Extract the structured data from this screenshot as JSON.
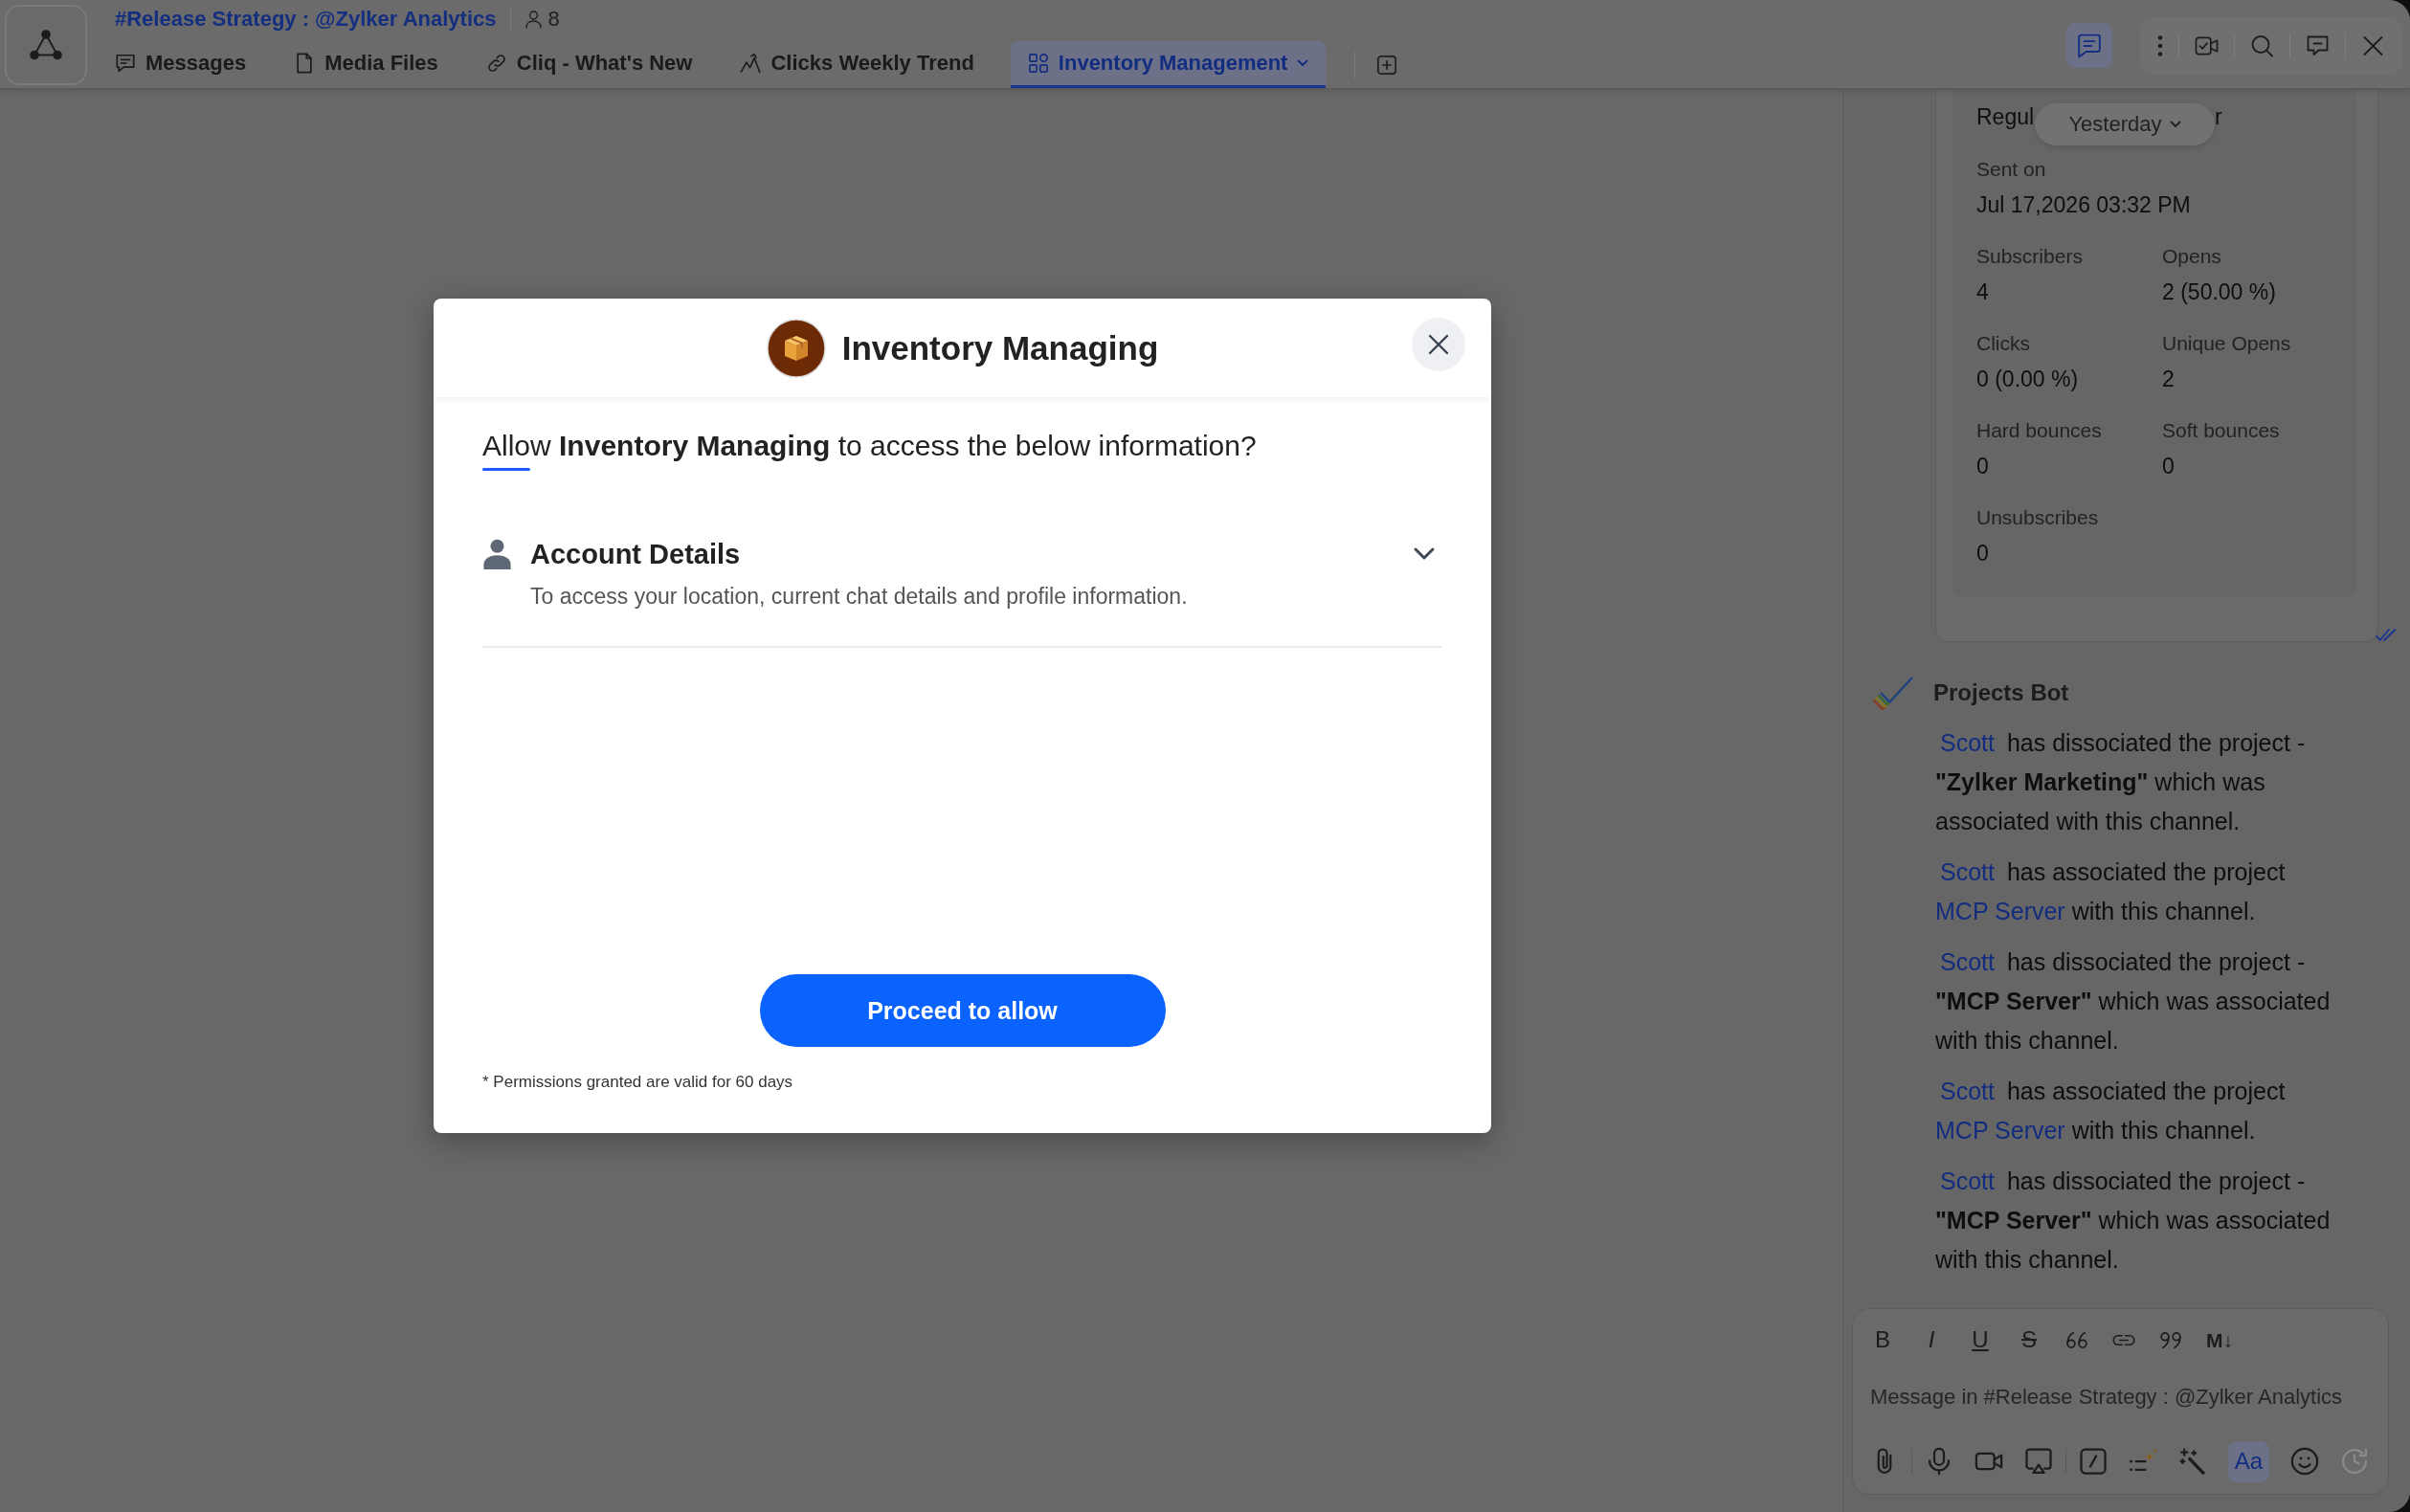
{
  "header": {
    "title": "#Release Strategy : @Zylker Analytics",
    "member_count": "8",
    "tabs": [
      {
        "kind": "chat",
        "label": "Messages",
        "selected": false
      },
      {
        "kind": "file",
        "label": "Media Files",
        "selected": false
      },
      {
        "kind": "link",
        "label": "Cliq - What's New",
        "selected": false
      },
      {
        "kind": "chart",
        "label": "Clicks Weekly Trend",
        "selected": false
      },
      {
        "kind": "widget",
        "label": "Inventory Management",
        "selected": true
      }
    ],
    "panel_toggle": {
      "on": true
    },
    "actions": [
      {
        "kind": "more"
      },
      {
        "kind": "video-call"
      },
      {
        "kind": "search"
      },
      {
        "kind": "thread"
      },
      {
        "kind": "close"
      }
    ]
  },
  "dialog": {
    "app_name": "Inventory Managing",
    "question": "Allow **Inventory Managing** to access the below information?",
    "permissions": [
      {
        "title": "Account Details",
        "description": "To access your location, current chat details and profile information.",
        "expanded": false
      }
    ],
    "primary_button": "Proceed to allow",
    "footnote": "* Permissions granted are valid for 60 days"
  },
  "side_panel": {
    "date_chip": "Yesterday",
    "campaign": {
      "cut_text_left": "Regul",
      "cut_text_right": "r",
      "sent_on": {
        "label": "Sent on",
        "value": "Jul 17,2026 03:32 PM"
      },
      "stats": [
        {
          "label": "Subscribers",
          "value": "4"
        },
        {
          "label": "Opens",
          "value": "2 (50.00 %)"
        },
        {
          "label": "Clicks",
          "value": "0 (0.00 %)"
        },
        {
          "label": "Unique Opens",
          "value": "2"
        },
        {
          "label": "Hard bounces",
          "value": "0"
        },
        {
          "label": "Soft bounces",
          "value": "0"
        },
        {
          "label": "Unsubscribes",
          "value": "0"
        }
      ]
    },
    "bot": {
      "name": "Projects Bot",
      "messages": [
        {
          "parts": [
            {
              "kind": "mention",
              "text": "Scott"
            },
            {
              "kind": "text",
              "text": "has dissociated the project - **\"Zylker Marketing\"** which was associated with this channel."
            }
          ]
        },
        {
          "parts": [
            {
              "kind": "mention",
              "text": "Scott"
            },
            {
              "kind": "text",
              "text": "has associated the project"
            },
            {
              "kind": "link",
              "text": "MCP Server"
            },
            {
              "kind": "text",
              "text": "with this channel."
            }
          ]
        },
        {
          "parts": [
            {
              "kind": "mention",
              "text": "Scott"
            },
            {
              "kind": "text",
              "text": "has dissociated the project - **\"MCP Server\"** which was associated with this channel."
            }
          ]
        },
        {
          "parts": [
            {
              "kind": "mention",
              "text": "Scott"
            },
            {
              "kind": "text",
              "text": "has associated the project"
            },
            {
              "kind": "link",
              "text": "MCP Server"
            },
            {
              "kind": "text",
              "text": "with this channel."
            }
          ]
        },
        {
          "parts": [
            {
              "kind": "mention",
              "text": "Scott"
            },
            {
              "kind": "text",
              "text": "has dissociated the project - **\"MCP Server\"** which was associated with this channel."
            }
          ]
        }
      ]
    },
    "composer": {
      "format_tools": [
        {
          "kind": "bold",
          "label": "B"
        },
        {
          "kind": "italic",
          "label": "I"
        },
        {
          "kind": "underline",
          "label": "U"
        },
        {
          "kind": "strike",
          "label": "S"
        },
        {
          "kind": "quote-open"
        },
        {
          "kind": "link"
        },
        {
          "kind": "quote-close"
        },
        {
          "kind": "markdown",
          "label": "M↓"
        }
      ],
      "placeholder": "Message in #Release Strategy : @Zylker Analytics",
      "action_groups": [
        [
          {
            "kind": "attach",
            "on": false,
            "disabled": false
          }
        ],
        [
          {
            "kind": "mic",
            "on": false,
            "disabled": false
          },
          {
            "kind": "video",
            "on": false,
            "disabled": false
          },
          {
            "kind": "screen-share",
            "on": false,
            "disabled": false
          }
        ],
        [
          {
            "kind": "slash",
            "on": false,
            "disabled": false
          },
          {
            "kind": "ai-list",
            "on": false,
            "disabled": false
          },
          {
            "kind": "magic-wand",
            "on": false,
            "disabled": false
          },
          {
            "kind": "text-format",
            "label": "Aa",
            "on": true,
            "disabled": false
          },
          {
            "kind": "emoji",
            "on": false,
            "disabled": false
          },
          {
            "kind": "schedule",
            "on": false,
            "disabled": true
          }
        ]
      ]
    }
  }
}
